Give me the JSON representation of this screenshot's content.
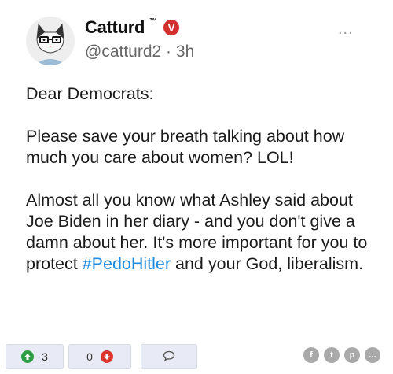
{
  "post": {
    "author_name": "Catturd",
    "trademark": "™",
    "handle": "@catturd2",
    "separator": "·",
    "time_ago": "3h",
    "verified_mark": "V",
    "more_label": "...",
    "paragraphs": {
      "p1": "Dear Democrats:",
      "p2": "Please save your breath talking about how much you care about women? LOL!",
      "p3_before": "Almost all you know what Ashley said about Joe Biden in her diary - and you don't give a damn about her. It's more important for you to protect ",
      "p3_hashtag": "#PedoHitler",
      "p3_after": " and your God, liberalism."
    }
  },
  "actions": {
    "upvote_count": "3",
    "downvote_count": "0"
  },
  "share": {
    "facebook_label": "f",
    "twitter_label": "t",
    "pinterest_label": "p",
    "more_label": "..."
  },
  "colors": {
    "accent_link": "#1d8ce0",
    "verified": "#d32f2f",
    "upvote": "#2e9e44",
    "downvote": "#d9362c"
  }
}
